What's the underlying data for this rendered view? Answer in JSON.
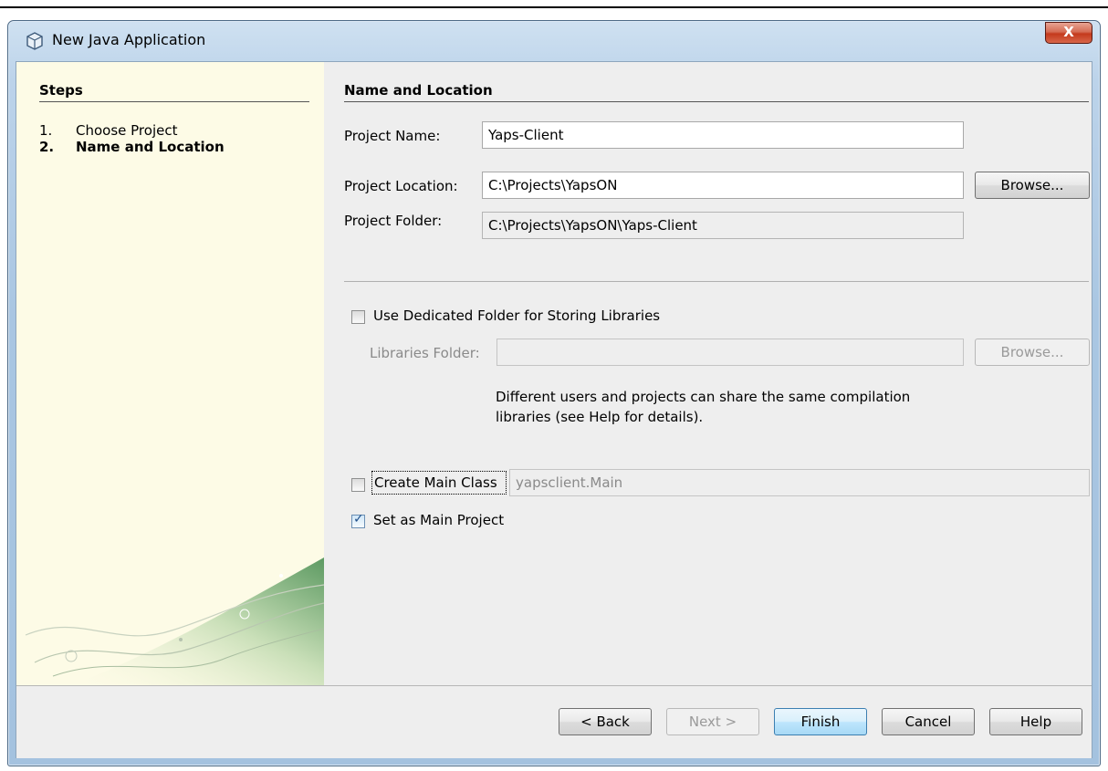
{
  "window": {
    "title": "New Java Application",
    "close_label": "X"
  },
  "steps": {
    "title": "Steps",
    "items": [
      {
        "number": "1.",
        "label": "Choose Project"
      },
      {
        "number": "2.",
        "label": "Name and Location"
      }
    ]
  },
  "main": {
    "section_title": "Name and Location",
    "project_name_label": "Project Name:",
    "project_name_value": "Yaps-Client",
    "project_location_label": "Project Location:",
    "project_location_value": "C:\\Projects\\YapsON",
    "browse_label": "Browse...",
    "project_folder_label": "Project Folder:",
    "project_folder_value": "C:\\Projects\\YapsON\\Yaps-Client",
    "dedicated_folder_label": "Use Dedicated Folder for Storing Libraries",
    "dedicated_folder_checked": false,
    "libraries_folder_label": "Libraries Folder:",
    "libraries_folder_value": "",
    "libraries_browse_label": "Browse...",
    "hint_line1": "Different users and projects can share the same compilation",
    "hint_line2": "libraries (see Help for details).",
    "create_main_class_label": "Create Main Class",
    "create_main_class_checked": false,
    "main_class_value": "yapsclient.Main",
    "set_main_project_label": "Set as Main Project",
    "set_main_project_checked": true
  },
  "footer": {
    "back_label": "< Back",
    "next_label": "Next >",
    "finish_label": "Finish",
    "cancel_label": "Cancel",
    "help_label": "Help"
  },
  "colors": {
    "steps_background": "#fdfbe6",
    "dialog_background": "#eeeeee",
    "close_button": "#c4391c",
    "default_button_border": "#3c7fb1"
  }
}
